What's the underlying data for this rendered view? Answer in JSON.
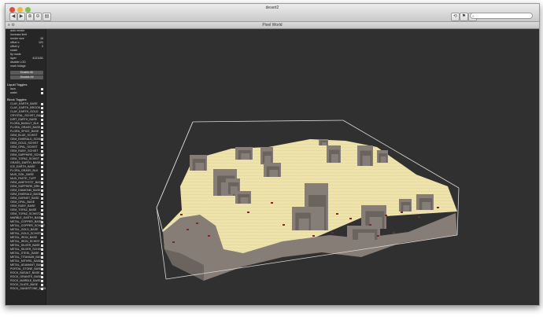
{
  "window": {
    "title": "desert2",
    "view_title": "Pixel World"
  },
  "toolbar": {
    "buttons": [
      "◀",
      "▶",
      "⊕",
      "⊖",
      "▤"
    ],
    "right_buttons": [
      "⟲",
      "⚑",
      "☰"
    ]
  },
  "search": {
    "placeholder": ""
  },
  "sidebar": {
    "controls": [
      {
        "label": "auto render",
        "value": ""
      },
      {
        "label": "increase limit",
        "value": ""
      },
      {
        "label": "render size",
        "value": "16"
      },
      {
        "label": "offset x",
        "value": "121"
      },
      {
        "label": "offset y",
        "value": "0"
      },
      {
        "label": "rotate",
        "value": ""
      }
    ],
    "fly_label": "fly mode",
    "layer_label": "layer",
    "layer_value": "4121151",
    "misc": [
      "disable LOD",
      "mark foliage"
    ],
    "enable_all": "Enable All",
    "disable_all": "Disable All",
    "liquid_header": "Liquid Toggles",
    "liquids": [
      "lava",
      "water"
    ],
    "block_header": "Block Toggles",
    "blocks": [
      "CLAY_EARTH_BASE",
      "CLAY_EARTH_BROOK",
      "CLAY_EARTH_GOLD",
      "CRYSTAL_SCHIST_BASE",
      "DIRT_EARTH_BASE",
      "FLORA_BASALT_BLK",
      "FLORA_GRASS_BASE",
      "FLORA_SPICE_BASE",
      "GEM_BLUE_SCHIST",
      "GEM_EMERALD_SCHIST",
      "GEM_GOLD_SCHIST",
      "GEM_OPAL_SCHIST",
      "GEM_RUBY_SCHIST",
      "GEM_SAPPHIRE_SCHIST",
      "GEM_TOPAZ_SCHIST",
      "GRASS_EARTH_BASE",
      "ICE_EARTH_BASE",
      "FLORA_GRASS_BLK",
      "MUD_SOIL_BASE",
      "MUD_PASTE_TUFF",
      "GEM_AMETHYST_BASE",
      "GEM_SAPPHIRE_BRK",
      "GEM_DIAMOND_BASE",
      "GEM_EMERALD_BASE",
      "GEM_GARNET_BASE",
      "GEM_OPAL_BASE",
      "GEM_RUBY_BASE",
      "GEM_TOPAZ_BASE",
      "GEM_TOPAZ_SCHIST2",
      "MARBLE_EARTH_BASE",
      "METAL_COPPER_BASE",
      "METAL_COPPER_SCHIST",
      "METAL_GOLD_BASE",
      "METAL_GOLD_SCHIST",
      "METAL_IRON_BASE",
      "METAL_IRON_SCHIST",
      "METAL_SILVER_BASE",
      "METAL_SILVER_SCHIST",
      "METAL_STEEL_BASE",
      "METAL_TITANIUM_BASE",
      "METAL_MITHRIL_BASE",
      "METAL_ADAMANT_BASE",
      "PORTAL_STONE_BASE",
      "ROCK_BASALT_BASE",
      "ROCK_GRANITE_BASE",
      "ROCK_MARBLE_BASE",
      "ROCK_SLATE_BASE",
      "ROCK_SANDSTONE_BASE"
    ]
  },
  "scene": {
    "sand_color": "#efe3ac",
    "rock_color": "#857d76",
    "rock_dark": "#6b645e",
    "foliage_color": "#8a2130",
    "bounds_color": "#d8d8d8"
  }
}
